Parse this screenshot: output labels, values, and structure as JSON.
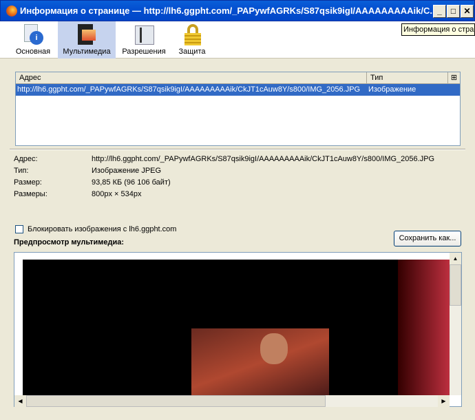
{
  "window": {
    "title": "Информация о странице — http://lh6.ggpht.com/_PAPywfAGRKs/S87qsik9igI/AAAAAAAAAik/C...",
    "minimize": "_",
    "maximize": "□",
    "close": "✕",
    "tooltip": "Информация о стран"
  },
  "tabs": [
    {
      "label": "Основная",
      "icon": "info-icon"
    },
    {
      "label": "Мультимедиа",
      "icon": "media-icon",
      "selected": true
    },
    {
      "label": "Разрешения",
      "icon": "permissions-icon"
    },
    {
      "label": "Защита",
      "icon": "lock-icon"
    }
  ],
  "list": {
    "columns": [
      "Адрес",
      "Тип"
    ],
    "rows": [
      {
        "address": "http://lh6.ggpht.com/_PAPywfAGRKs/S87qsik9igI/AAAAAAAAAik/CkJT1cAuw8Y/s800/IMG_2056.JPG",
        "type": "Изображение"
      }
    ]
  },
  "details": [
    {
      "label": "Адрес:",
      "value": "http://lh6.ggpht.com/_PAPywfAGRKs/S87qsik9igI/AAAAAAAAAik/CkJT1cAuw8Y/s800/IMG_2056.JPG"
    },
    {
      "label": "Тип:",
      "value": "Изображение JPEG"
    },
    {
      "label": "Размер:",
      "value": "93,85 КБ (96 106 байт)"
    },
    {
      "label": "Размеры:",
      "value": "800px × 534px"
    }
  ],
  "block_checkbox": {
    "label": "Блокировать изображения с lh6.ggpht.com",
    "checked": false
  },
  "preview_heading": "Предпросмотр мультимедиа:",
  "save_button": "Сохранить как..."
}
